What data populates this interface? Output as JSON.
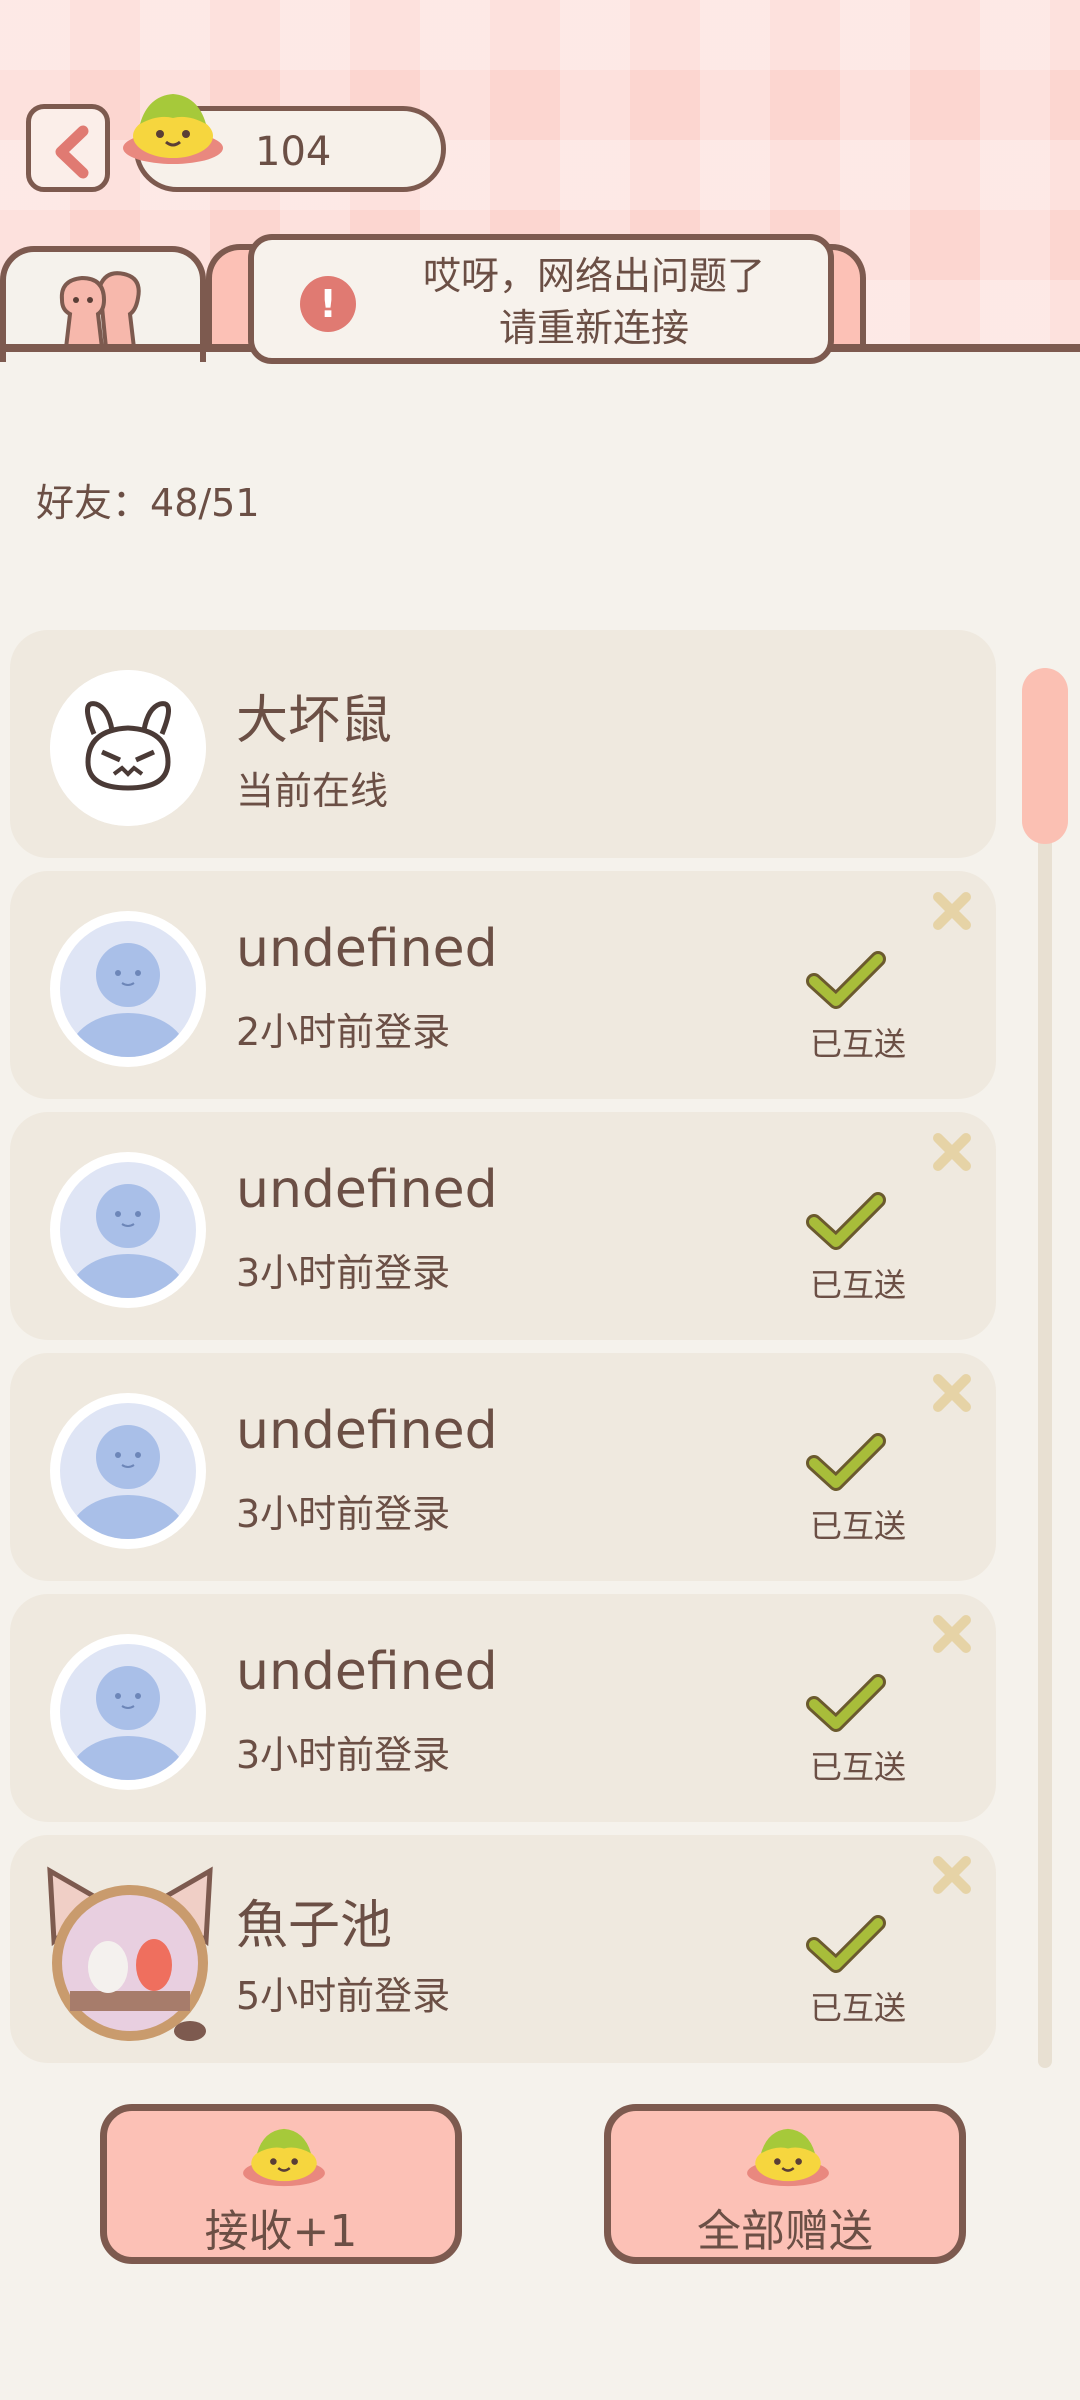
{
  "header": {
    "currency_value": "104",
    "toast_line1": "哎呀，网络出问题了",
    "toast_line2": "请重新连接",
    "toast_icon": "!"
  },
  "friends": {
    "count_label": "好友：",
    "count_value": "48/51",
    "items": [
      {
        "name": "大坏鼠",
        "status": "当前在线",
        "avatar": "rabbit-avatar",
        "sent": false,
        "removable": false
      },
      {
        "name": "undefined",
        "status": "2小时前登录",
        "avatar": "default-avatar",
        "sent": true,
        "sent_label": "已互送",
        "removable": true
      },
      {
        "name": "undefined",
        "status": "3小时前登录",
        "avatar": "default-avatar",
        "sent": true,
        "sent_label": "已互送",
        "removable": true
      },
      {
        "name": "undefined",
        "status": "3小时前登录",
        "avatar": "default-avatar",
        "sent": true,
        "sent_label": "已互送",
        "removable": true
      },
      {
        "name": "undefined",
        "status": "3小时前登录",
        "avatar": "default-avatar",
        "sent": true,
        "sent_label": "已互送",
        "removable": true
      },
      {
        "name": "魚子池",
        "status": "5小时前登录",
        "avatar": "cat-photo-avatar",
        "sent": true,
        "sent_label": "已互送",
        "removable": true
      }
    ]
  },
  "buttons": {
    "receive_label": "接收+1",
    "give_all_label": "全部赠送"
  },
  "colors": {
    "brown_outline": "#7d5a4f",
    "text": "#6b4f45",
    "pink": "#fcc1b6",
    "card_bg": "#efe9df",
    "check_green": "#a8bd3a",
    "remove_x": "#e6d3a6"
  }
}
